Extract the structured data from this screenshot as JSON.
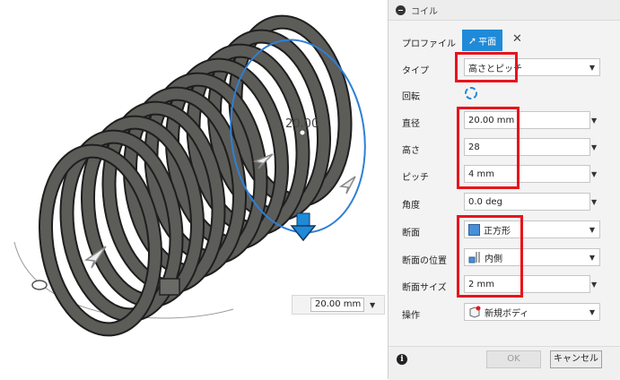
{
  "viewport": {
    "dimension_label": "20.00",
    "dimension_input": "20.00 mm"
  },
  "panel": {
    "title": "コイル",
    "profile": {
      "label": "プロファイル",
      "button": "平面"
    },
    "type": {
      "label": "タイプ",
      "value": "高さとピッチ"
    },
    "rotation": {
      "label": "回転"
    },
    "diameter": {
      "label": "直径",
      "value": "20.00 mm"
    },
    "height": {
      "label": "高さ",
      "value": "28"
    },
    "pitch": {
      "label": "ピッチ",
      "value": "4 mm"
    },
    "angle": {
      "label": "角度",
      "value": "0.0 deg"
    },
    "section": {
      "label": "断面",
      "value": "正方形"
    },
    "section_position": {
      "label": "断面の位置",
      "value": "内側"
    },
    "section_size": {
      "label": "断面サイズ",
      "value": "2 mm"
    },
    "operation": {
      "label": "操作",
      "value": "新規ボディ"
    },
    "ok": "OK",
    "cancel": "キャンセル"
  },
  "colors": {
    "accent": "#1f8ad8",
    "highlight": "#e8141c",
    "coil": "#5c5c58"
  }
}
